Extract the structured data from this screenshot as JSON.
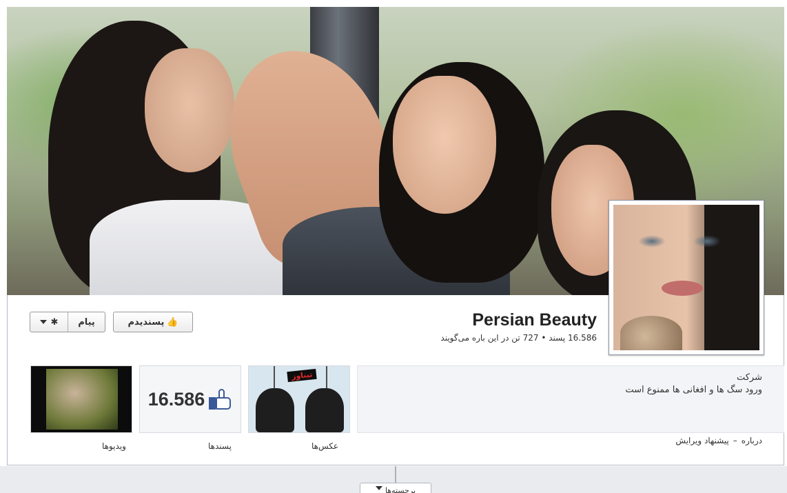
{
  "page": {
    "name": "Persian Beauty",
    "stats": "16.586 پسند • 727 تن در این باره می‌گویند"
  },
  "actions": {
    "like_label": "پسندیدم",
    "message_label": "پیام",
    "gear_icon": "gear-icon",
    "like_icon": "thumbs-up-icon"
  },
  "about": {
    "category": "شرکت",
    "description": "ورود سگ ها و افغانی ها ممنوع است",
    "link_about": "درباره",
    "separator": "–",
    "link_suggest_edit": "پیشنهاد ویرایش"
  },
  "apps": [
    {
      "id": "photos",
      "label": "عکس‌ها",
      "thumb_text": "تیناوز"
    },
    {
      "id": "likes",
      "label": "پسندها",
      "count": "16.586"
    },
    {
      "id": "videos",
      "label": "ویدیوها"
    }
  ],
  "timeline": {
    "button_label": "برجسته‌ها"
  },
  "colors": {
    "facebook_blue": "#3b5998",
    "border": "#b3bac7",
    "about_bg": "#f3f4f7"
  }
}
